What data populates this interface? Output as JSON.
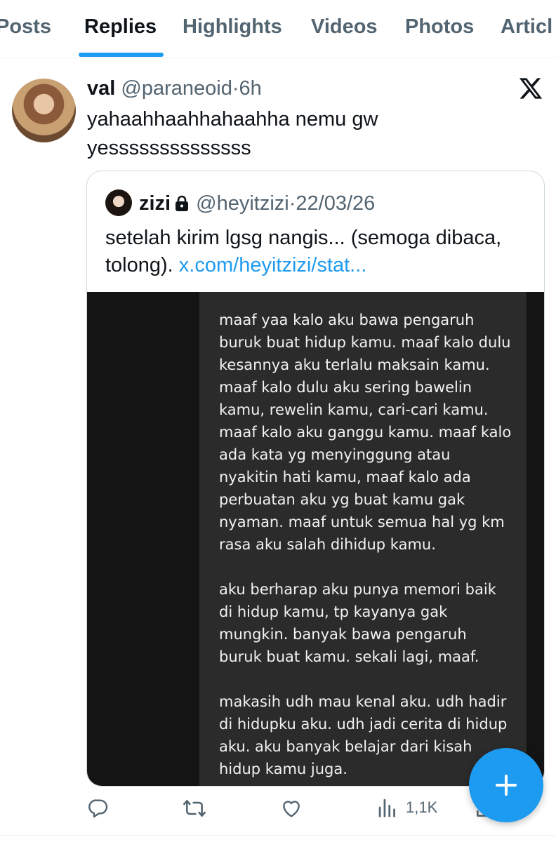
{
  "tabs": [
    {
      "label": "Posts"
    },
    {
      "label": "Replies"
    },
    {
      "label": "Highlights"
    },
    {
      "label": "Videos"
    },
    {
      "label": "Photos"
    },
    {
      "label": "Articl"
    }
  ],
  "active_tab": "Replies",
  "post": {
    "display_name": "val",
    "handle": "@paraneoid",
    "separator": "·",
    "time": "6h",
    "text": "yahaahhaahhahaahha nemu gw yessssssssssssss",
    "logo_icon": "x-logo-icon",
    "quote": {
      "display_name": "zizi",
      "handle": "@heyitzizi",
      "separator": "·",
      "date": "22/03/26",
      "text": "setelah kirim lgsg nangis... (semoga dibaca, tolong).",
      "link": "x.com/heyitzizi/stat...",
      "image_text": {
        "para1": "maaf yaa kalo aku bawa pengaruh buruk buat hidup kamu. maaf kalo dulu kesannya aku terlalu maksain kamu. maaf kalo dulu aku sering bawelin kamu, rewelin kamu, cari-cari kamu. maaf kalo aku ganggu kamu. maaf kalo ada kata yg menyinggung atau nyakitin hati kamu, maaf kalo ada perbuatan aku yg buat kamu gak nyaman. maaf untuk semua hal yg km rasa aku salah dihidup kamu.",
        "para2": "aku berharap aku punya memori baik di hidup kamu, tp kayanya gak mungkin. banyak bawa pengaruh buruk buat kamu. sekali lagi, maaf.",
        "para3": "makasih udh mau kenal aku. udh hadir di hidupku aku. udh jadi cerita di hidup aku. aku banyak belajar dari kisah hidup kamu juga."
      }
    },
    "actions": {
      "views": "1,1K"
    }
  },
  "colors": {
    "accent": "#1d9bf0",
    "secondary_text": "#536471",
    "media_panel": "#2b2b2c"
  }
}
